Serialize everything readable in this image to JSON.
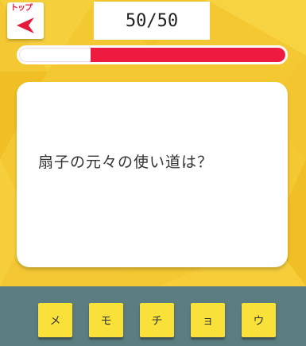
{
  "top_button": {
    "label": "トップ"
  },
  "counter": "50/50",
  "progress": {
    "fraction": 0.73,
    "fill_color": "#ee1b40"
  },
  "question": "扇子の元々の使い道は？",
  "answer_tiles": [
    "メ",
    "モ",
    "チ",
    "ョ",
    "ウ"
  ],
  "colors": {
    "background": "#f4c832",
    "panel": "#5b7d80",
    "tile": "#f9e13a"
  }
}
